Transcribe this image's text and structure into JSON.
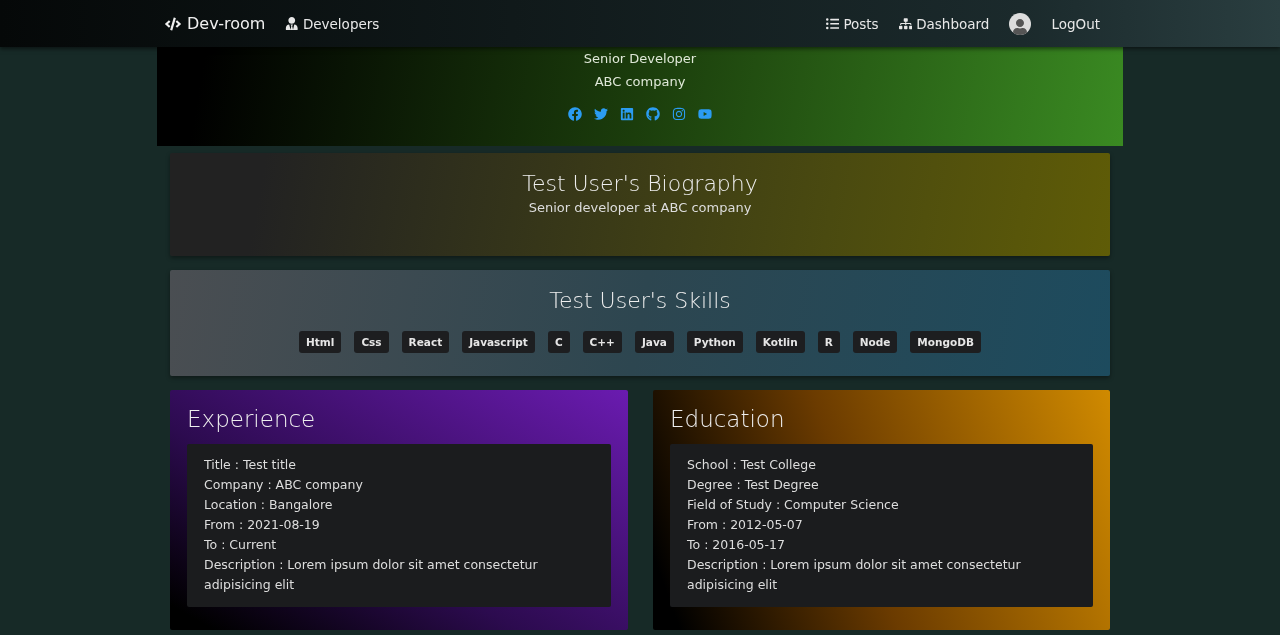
{
  "navbar": {
    "brand": "Dev-room",
    "left_links": [
      {
        "label": "Developers",
        "kind": "developers"
      }
    ],
    "right_links": [
      {
        "label": "Posts",
        "kind": "list"
      },
      {
        "label": "Dashboard",
        "kind": "sitemap"
      }
    ],
    "logout": "LogOut"
  },
  "profile": {
    "status": "Senior Developer",
    "company": "ABC company",
    "social": [
      {
        "kind": "facebook"
      },
      {
        "kind": "twitter"
      },
      {
        "kind": "linkedin"
      },
      {
        "kind": "github"
      },
      {
        "kind": "instagram"
      },
      {
        "kind": "youtube"
      }
    ]
  },
  "biography": {
    "title": "Test User's Biography",
    "text": "Senior developer at ABC company"
  },
  "skills": {
    "title": "Test User's Skills",
    "items": [
      "Html",
      "Css",
      "React",
      "Javascript",
      "C",
      "C++",
      "Java",
      "Python",
      "Kotlin",
      "R",
      "Node",
      "MongoDB"
    ]
  },
  "experience": {
    "title": "Experience",
    "lines": [
      "Title : Test title",
      "Company : ABC company",
      "Location : Bangalore",
      "From : 2021-08-19",
      "To : Current",
      "Description : Lorem ipsum dolor sit amet consectetur adipisicing elit"
    ]
  },
  "education": {
    "title": "Education",
    "lines": [
      "School : Test College",
      "Degree : Test Degree",
      "Field of Study : Computer Science",
      "From : 2012-05-07",
      "To : 2016-05-17",
      "Description : Lorem ipsum dolor sit amet consectetur adipisicing elit"
    ]
  }
}
